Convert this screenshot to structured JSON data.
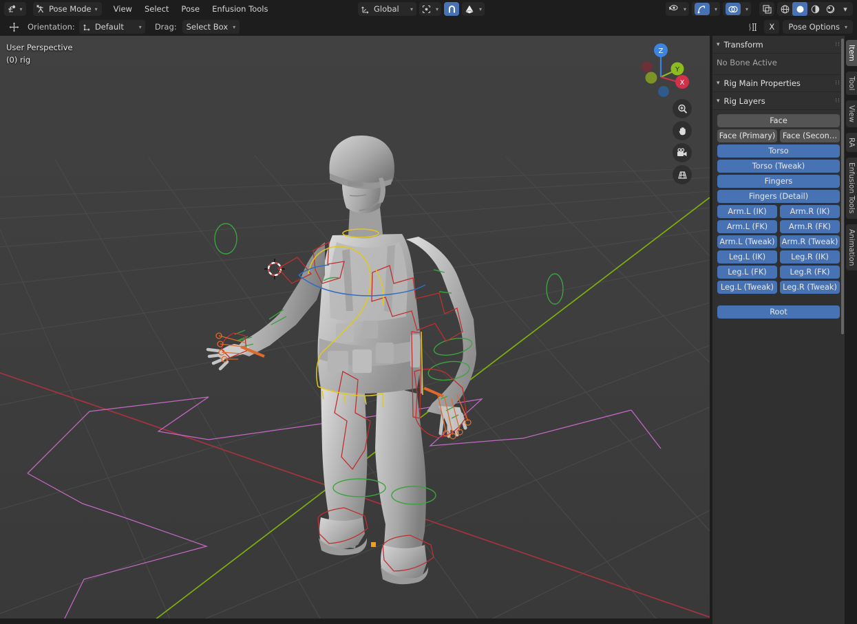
{
  "app": {
    "name": "Blender",
    "mode": "Pose Mode"
  },
  "header": {
    "editor_type_icon": "editor-type-icon",
    "mode_icon": "pose-mode-icon",
    "mode": "Pose Mode",
    "menus": [
      "View",
      "Select",
      "Pose",
      "Enfusion Tools"
    ],
    "transform_orientation_icon": "orientation-axis-icon",
    "transform_orientation": "Global",
    "pivot_icon": "pivot-point-icon",
    "snap_icon": "magnet-icon",
    "snap_active": true,
    "proportional_icon": "proportional-edit-icon",
    "visibility_icon": "object-visibility-icon",
    "gizmo_icon": "gizmo-icon",
    "overlays_icon": "overlays-icon",
    "xray_icon": "toggle-xray-icon",
    "shading_modes": [
      "wireframe-shading",
      "solid-shading",
      "material-shading",
      "rendered-shading"
    ],
    "shading_active_index": 1
  },
  "toolbar": {
    "transform_icon": "move-tool-icon",
    "orientation_label": "Orientation:",
    "orientation_icon": "orientation-dropdown-icon",
    "orientation_value": "Default",
    "drag_label": "Drag:",
    "drag_value": "Select Box",
    "pose_copy_icon": "copy-pose-icon",
    "pose_x_label": "X",
    "pose_options_label": "Pose Options"
  },
  "viewport": {
    "perspective_label": "User Perspective",
    "scene_label": "(0) rig",
    "background_color": "#3d3d3d",
    "grid_color": "#4a4a4a",
    "axis_x_color": "#c0392f",
    "axis_y_color": "#7fb00a",
    "gizmo": {
      "axes": [
        {
          "name": "Z",
          "color": "#3b84e0",
          "label": "Z"
        },
        {
          "name": "Y",
          "color": "#8cbd20",
          "label": "Y"
        },
        {
          "name": "X",
          "color": "#d3304a",
          "label": "X"
        }
      ],
      "negative_axes": [
        {
          "name": "-X",
          "color": "#6b3038"
        },
        {
          "name": "-Y",
          "color": "#6f8420"
        },
        {
          "name": "-Z",
          "color": "#2f5a8c"
        }
      ]
    },
    "nav_buttons": [
      "zoom-icon",
      "pan-hand-icon",
      "camera-icon",
      "ortho-persp-icon"
    ],
    "bone_colors": {
      "ik": "#c92a2a",
      "fk": "#2e9e3e",
      "tweak": "#37a23b",
      "torso": "#e0c21a",
      "root": "#cc62cc",
      "spine": "#2f6fc0",
      "finger": "#e0662a"
    }
  },
  "sidebar": {
    "sections": [
      {
        "id": "transform",
        "title": "Transform",
        "grip": "icon-grip"
      },
      {
        "id": "rig_main",
        "title": "Rig Main Properties",
        "grip": "icon-grip"
      },
      {
        "id": "rig_layers",
        "title": "Rig Layers",
        "grip": "icon-grip"
      }
    ],
    "transform": {
      "empty_text": "No Bone Active"
    },
    "rig_layers": {
      "rows": [
        {
          "type": "full",
          "buttons": [
            {
              "label": "Face",
              "active": false
            }
          ]
        },
        {
          "type": "pair",
          "buttons": [
            {
              "label": "Face (Primary)",
              "active": false
            },
            {
              "label": "Face (Secon…",
              "active": false
            }
          ]
        },
        {
          "type": "full",
          "buttons": [
            {
              "label": "Torso",
              "active": true
            }
          ]
        },
        {
          "type": "full",
          "buttons": [
            {
              "label": "Torso (Tweak)",
              "active": true
            }
          ]
        },
        {
          "type": "full",
          "buttons": [
            {
              "label": "Fingers",
              "active": true
            }
          ]
        },
        {
          "type": "full",
          "buttons": [
            {
              "label": "Fingers (Detail)",
              "active": true
            }
          ]
        },
        {
          "type": "pair",
          "buttons": [
            {
              "label": "Arm.L (IK)",
              "active": true
            },
            {
              "label": "Arm.R (IK)",
              "active": true
            }
          ]
        },
        {
          "type": "pair",
          "buttons": [
            {
              "label": "Arm.L (FK)",
              "active": true
            },
            {
              "label": "Arm.R (FK)",
              "active": true
            }
          ]
        },
        {
          "type": "pair",
          "buttons": [
            {
              "label": "Arm.L (Tweak)",
              "active": true
            },
            {
              "label": "Arm.R (Tweak)",
              "active": true
            }
          ]
        },
        {
          "type": "pair",
          "buttons": [
            {
              "label": "Leg.L (IK)",
              "active": true
            },
            {
              "label": "Leg.R (IK)",
              "active": true
            }
          ]
        },
        {
          "type": "pair",
          "buttons": [
            {
              "label": "Leg.L (FK)",
              "active": true
            },
            {
              "label": "Leg.R (FK)",
              "active": true
            }
          ]
        },
        {
          "type": "pair",
          "buttons": [
            {
              "label": "Leg.L (Tweak)",
              "active": true
            },
            {
              "label": "Leg.R (Tweak)",
              "active": true
            }
          ]
        },
        {
          "type": "spacer",
          "buttons": []
        },
        {
          "type": "full",
          "buttons": [
            {
              "label": "Root",
              "active": true
            }
          ]
        }
      ],
      "active_color": "#4772b3",
      "inactive_color": "#545454"
    },
    "tabs": [
      {
        "label": "Item",
        "active": true
      },
      {
        "label": "Tool",
        "active": false
      },
      {
        "label": "View",
        "active": false
      },
      {
        "label": "RA",
        "active": false
      },
      {
        "label": "Enfusion Tools",
        "active": false
      },
      {
        "label": "Animation",
        "active": false
      }
    ]
  }
}
